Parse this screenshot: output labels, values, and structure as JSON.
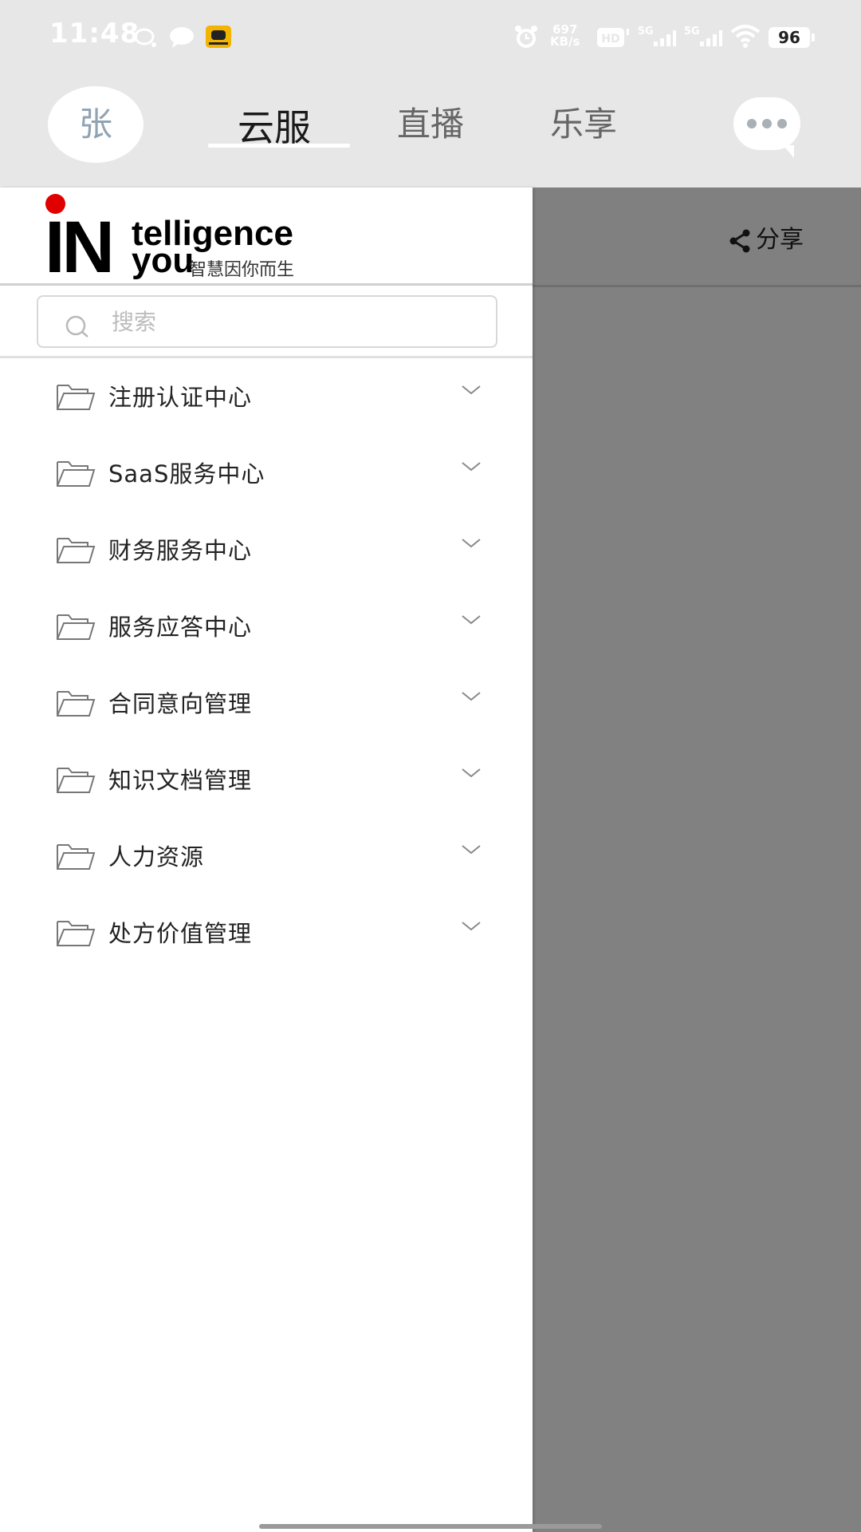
{
  "status_bar": {
    "time": "11:48",
    "net_speed_value": "697",
    "net_speed_unit": "KB/s",
    "battery": "96"
  },
  "header": {
    "avatar_text": "张",
    "tabs": [
      {
        "label": "云服",
        "active": true
      },
      {
        "label": "直播",
        "active": false
      },
      {
        "label": "乐享",
        "active": false
      }
    ]
  },
  "logo": {
    "big": "IN",
    "line1": "telligence",
    "line2": "you",
    "slogan": "智慧因你而生"
  },
  "search": {
    "placeholder": "搜索",
    "value": ""
  },
  "share": {
    "label": "分享"
  },
  "menu": {
    "items": [
      {
        "label": "注册认证中心"
      },
      {
        "label": "SaaS服务中心"
      },
      {
        "label": "财务服务中心"
      },
      {
        "label": "服务应答中心"
      },
      {
        "label": "合同意向管理"
      },
      {
        "label": "知识文档管理"
      },
      {
        "label": "人力资源"
      },
      {
        "label": "处方价值管理"
      }
    ]
  },
  "colors": {
    "top_bg": "#e7e7e7",
    "overlay": "#818181",
    "logo_dot": "#e00000"
  }
}
